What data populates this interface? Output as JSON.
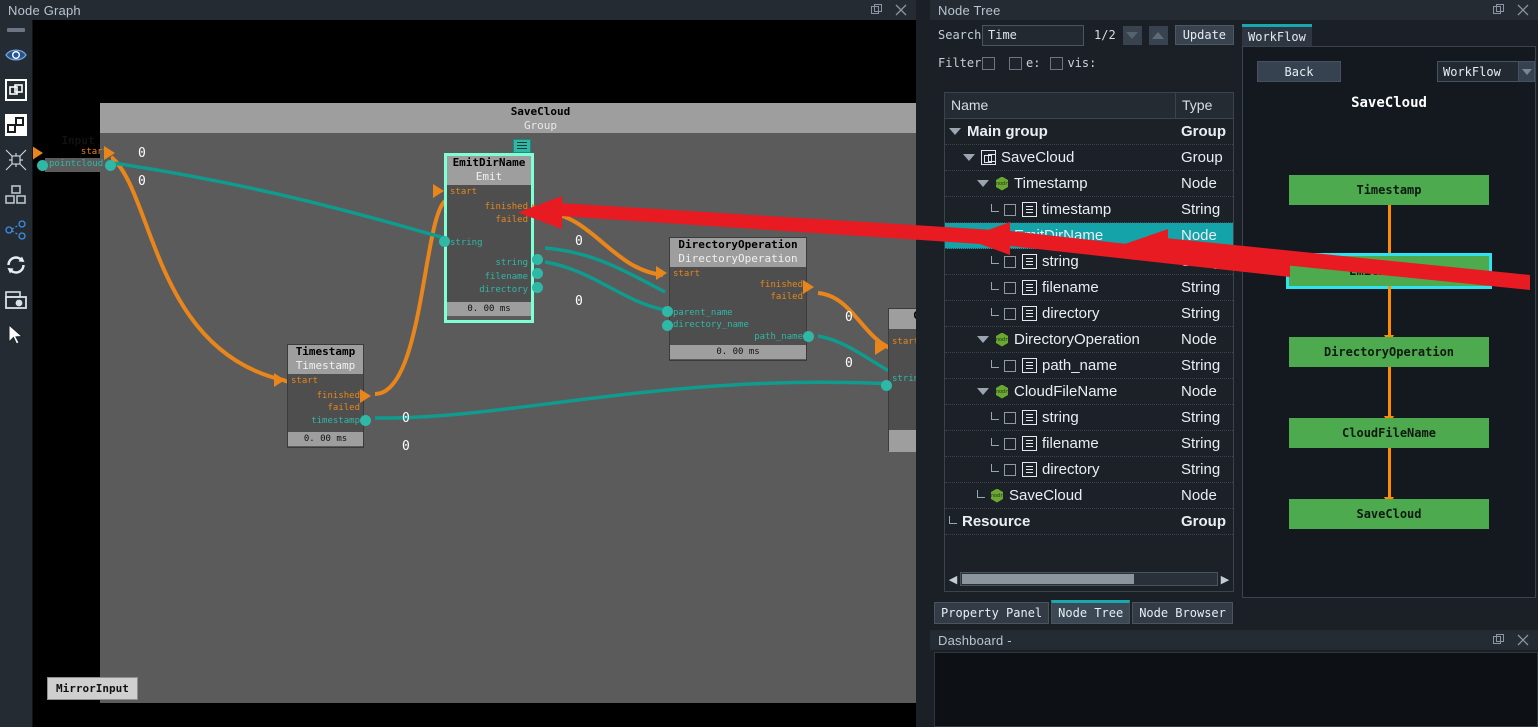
{
  "windows": {
    "node_graph": {
      "title": "Node Graph",
      "restore_icon": "restore-icon",
      "close_icon": "close-icon"
    },
    "node_tree": {
      "title": "Node Tree",
      "restore_icon": "restore-icon",
      "close_icon": "close-icon"
    },
    "dashboard": {
      "title": "Dashboard -",
      "restore_icon": "restore-icon",
      "close_icon": "close-icon"
    }
  },
  "toolbar": {
    "items": [
      {
        "name": "handle-grip",
        "icon": "grip-icon"
      },
      {
        "name": "visibility",
        "icon": "eye-icon"
      },
      {
        "name": "group",
        "icon": "group-box-icon"
      },
      {
        "name": "nodes",
        "icon": "two-squares-icon"
      },
      {
        "name": "collapse",
        "icon": "collapse-star-icon"
      },
      {
        "name": "layout",
        "icon": "layout-squares-icon"
      },
      {
        "name": "share",
        "icon": "share-nodes-icon"
      },
      {
        "name": "refresh",
        "icon": "refresh-icon"
      },
      {
        "name": "snapshot",
        "icon": "camera-icon"
      },
      {
        "name": "select",
        "icon": "cursor-arrow-icon"
      }
    ]
  },
  "graph": {
    "group": {
      "title": "SaveCloud",
      "subtitle": "Group"
    },
    "mirror_tab": "MirrorInput",
    "nodes": [
      {
        "name": "Input",
        "type": "",
        "ports_left": [
          "start",
          "pointcloud"
        ],
        "ports_right": [],
        "badges": [
          "0",
          "0"
        ]
      },
      {
        "name": "EmitDirName",
        "type": "Emit",
        "selected": true,
        "ports_left": [
          "start",
          "string"
        ],
        "ports_right": [
          "finished",
          "failed",
          "string",
          "filename",
          "directory"
        ],
        "duration": "0. 00 ms",
        "badges": [
          "0",
          "0"
        ]
      },
      {
        "name": "DirectoryOperation",
        "type": "DirectoryOperation",
        "selected": false,
        "ports_left": [
          "start",
          "parent_name",
          "directory_name"
        ],
        "ports_right": [
          "finished",
          "failed",
          "path_name"
        ],
        "duration": "0. 00 ms",
        "badges": [
          "0",
          "0"
        ]
      },
      {
        "name": "Timestamp",
        "type": "Timestamp",
        "selected": false,
        "ports_left": [
          "start"
        ],
        "ports_right": [
          "finished",
          "failed",
          "timestamp"
        ],
        "duration": "0. 00 ms",
        "badges": [
          "0",
          "0"
        ]
      },
      {
        "name": "Clo",
        "type": "",
        "selected": false,
        "ports_left": [
          "start",
          "string"
        ],
        "ports_right": [],
        "duration": "",
        "badges": []
      }
    ]
  },
  "node_tree": {
    "search_label": "Search:",
    "search_value": "Time",
    "search_placeholder": "",
    "counter": "1/2",
    "prev_icon": "triangle-down-icon",
    "next_icon": "triangle-up-icon",
    "update_label": "Update",
    "filter_label": "Filter:",
    "filter_checkboxes": [
      {
        "label": ""
      },
      {
        "label": "e:"
      },
      {
        "label": "vis:"
      }
    ],
    "columns": {
      "name": "Name",
      "type": "Type"
    },
    "rows": [
      {
        "label": "Main group",
        "type": "Group",
        "depth": 0,
        "icon": "none",
        "twisty": true,
        "bold": true,
        "checkbox": false,
        "selected": false
      },
      {
        "label": "SaveCloud",
        "type": "Group",
        "depth": 1,
        "icon": "group-icon",
        "twisty": true,
        "bold": false,
        "checkbox": false,
        "selected": false
      },
      {
        "label": "Timestamp",
        "type": "Node",
        "depth": 2,
        "icon": "node-icon",
        "twisty": true,
        "bold": false,
        "checkbox": false,
        "selected": false
      },
      {
        "label": "timestamp",
        "type": "String",
        "depth": 3,
        "icon": "string-icon",
        "twisty": false,
        "bold": false,
        "checkbox": true,
        "selected": false
      },
      {
        "label": "EmitDirName",
        "type": "Node",
        "depth": 2,
        "icon": "node-icon",
        "twisty": true,
        "bold": false,
        "checkbox": false,
        "selected": true
      },
      {
        "label": "string",
        "type": "String",
        "depth": 3,
        "icon": "string-icon",
        "twisty": false,
        "bold": false,
        "checkbox": true,
        "selected": false
      },
      {
        "label": "filename",
        "type": "String",
        "depth": 3,
        "icon": "string-icon",
        "twisty": false,
        "bold": false,
        "checkbox": true,
        "selected": false
      },
      {
        "label": "directory",
        "type": "String",
        "depth": 3,
        "icon": "string-icon",
        "twisty": false,
        "bold": false,
        "checkbox": true,
        "selected": false
      },
      {
        "label": "DirectoryOperation",
        "type": "Node",
        "depth": 2,
        "icon": "node-icon",
        "twisty": true,
        "bold": false,
        "checkbox": false,
        "selected": false
      },
      {
        "label": "path_name",
        "type": "String",
        "depth": 3,
        "icon": "string-icon",
        "twisty": false,
        "bold": false,
        "checkbox": true,
        "selected": false
      },
      {
        "label": "CloudFileName",
        "type": "Node",
        "depth": 2,
        "icon": "node-icon",
        "twisty": true,
        "bold": false,
        "checkbox": false,
        "selected": false
      },
      {
        "label": "string",
        "type": "String",
        "depth": 3,
        "icon": "string-icon",
        "twisty": false,
        "bold": false,
        "checkbox": true,
        "selected": false
      },
      {
        "label": "filename",
        "type": "String",
        "depth": 3,
        "icon": "string-icon",
        "twisty": false,
        "bold": false,
        "checkbox": true,
        "selected": false
      },
      {
        "label": "directory",
        "type": "String",
        "depth": 3,
        "icon": "string-icon",
        "twisty": false,
        "bold": false,
        "checkbox": true,
        "selected": false
      },
      {
        "label": "SaveCloud",
        "type": "Node",
        "depth": 2,
        "icon": "node-icon",
        "twisty": false,
        "bold": false,
        "checkbox": false,
        "selected": false
      },
      {
        "label": "Resource",
        "type": "Group",
        "depth": 0,
        "icon": "none",
        "twisty": false,
        "bold": true,
        "checkbox": false,
        "selected": false
      }
    ],
    "scroll_left_icon": "chevron-left-icon",
    "scroll_right_icon": "chevron-right-icon"
  },
  "bottom_tabs": [
    {
      "label": "Property Panel",
      "active": false
    },
    {
      "label": "Node Tree",
      "active": true
    },
    {
      "label": "Node Browser",
      "active": false
    }
  ],
  "workflow": {
    "tab_label": "WorkFlow",
    "back_label": "Back",
    "combo_value": "WorkFlow",
    "combo_arrow_icon": "chevron-down-icon",
    "heading": "SaveCloud",
    "nodes": [
      {
        "label": "Timestamp",
        "selected": false
      },
      {
        "label": "EmitDirName",
        "selected": true
      },
      {
        "label": "DirectoryOperation",
        "selected": false
      },
      {
        "label": "CloudFileName",
        "selected": false
      },
      {
        "label": "SaveCloud",
        "selected": false
      }
    ]
  },
  "colors": {
    "accent": "#14a3a8",
    "selection_highlight": "#2fe2f0",
    "workflow_node": "#4eaa4e",
    "workflow_arrow": "#ff8c00",
    "exec_link": "#e8861b",
    "data_link": "#2fb8a6",
    "annotation_arrow": "#e81b23"
  }
}
